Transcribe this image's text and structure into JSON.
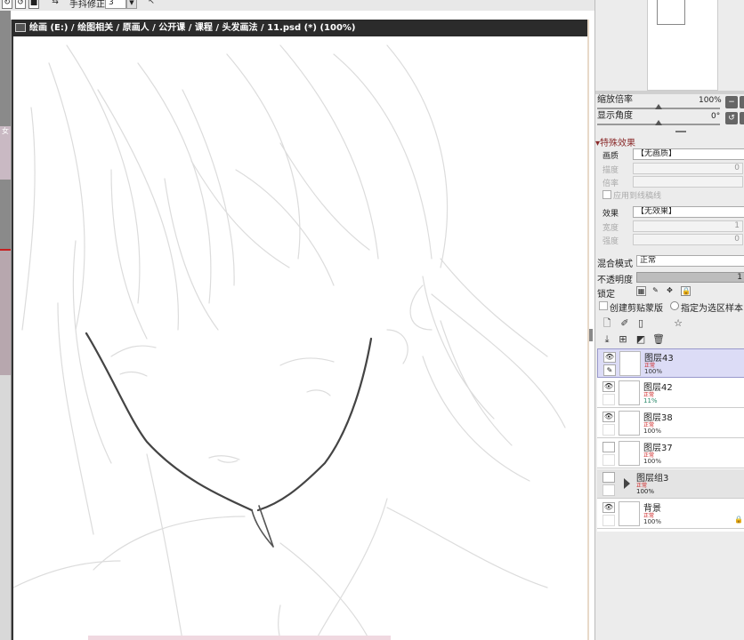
{
  "toolbar": {
    "label": "手抖修正",
    "value": "3",
    "dropdown_glyph": "▼",
    "icons": [
      "refresh-icon",
      "redo-icon",
      "square-icon",
      "swap-icon"
    ]
  },
  "canvas_window": {
    "title": "绘画 (E:) / 绘图相关 / 原画人 / 公开课 / 课程 / 头发画法 / 11.psd (*) (100%)"
  },
  "left_strip": {
    "tab_char": "女"
  },
  "navigator": {
    "zoom_label": "缩放倍率",
    "zoom_value": "100%",
    "angle_label": "显示角度",
    "angle_value": "0°",
    "btn_minus": "−",
    "btn_rotate": "↺"
  },
  "effects": {
    "header": "▾特殊效果",
    "texture_label": "画质",
    "texture_value": "【无画质】",
    "scale_label": "描度",
    "scale_value": "0",
    "multiplier_label": "倍率",
    "apply_linework": "应用到线稿线",
    "effect_label": "效果",
    "effect_value": "【无效果】",
    "width_label": "宽度",
    "width_value": "1",
    "strength_label": "强度",
    "strength_value": "0"
  },
  "layer_props": {
    "blend_label": "混合模式",
    "blend_value": "正常",
    "opacity_label": "不透明度",
    "opacity_value": "1",
    "lock_label": "锁定",
    "clipping_label": "创建剪贴蒙版",
    "selection_source_label": "指定为选区样本"
  },
  "layers": [
    {
      "name": "图层43",
      "mode": "正常",
      "opacity": "100%",
      "visible": true,
      "selected": true,
      "group": false,
      "teal": false
    },
    {
      "name": "图层42",
      "mode": "正常",
      "opacity": "11%",
      "visible": true,
      "selected": false,
      "group": false,
      "teal": true
    },
    {
      "name": "图层38",
      "mode": "正常",
      "opacity": "100%",
      "visible": true,
      "selected": false,
      "group": false,
      "teal": false
    },
    {
      "name": "图层37",
      "mode": "正常",
      "opacity": "100%",
      "visible": false,
      "selected": false,
      "group": false,
      "teal": false
    },
    {
      "name": "图层组3",
      "mode": "正常",
      "opacity": "100%",
      "visible": false,
      "selected": false,
      "group": true,
      "teal": false
    },
    {
      "name": "背景",
      "mode": "正常",
      "opacity": "100%",
      "visible": true,
      "selected": false,
      "group": false,
      "teal": false
    }
  ],
  "colors": {
    "titlebar": "#2b2b2b",
    "selected_layer": "#dcdcf6",
    "accent_red": "#c62020"
  }
}
